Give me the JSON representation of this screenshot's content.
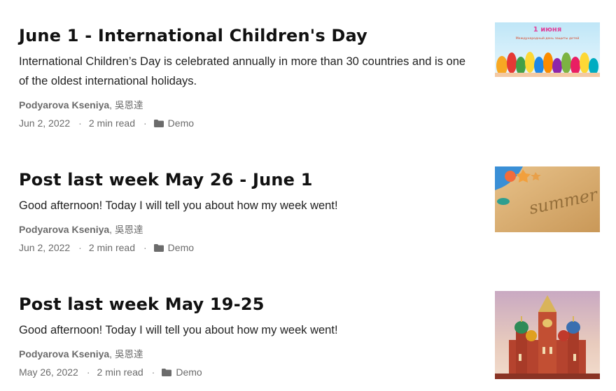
{
  "posts": [
    {
      "title": "June 1 - International Children's Day",
      "summary": "International Children’s Day is celebrated annually in more than 30 countries and is one of the oldest international holidays.",
      "author_primary": "Podyarova Kseniya",
      "author_separator": ",",
      "author_secondary": "吳恩達",
      "date": "Jun 2, 2022",
      "read_time": "2 min read",
      "category": "Demo",
      "meta_separator": "·",
      "image_icon": "childrens-day-thumbnail",
      "image_text_top": "1 июня",
      "image_text_sub": "Международный день защиты детей"
    },
    {
      "title": "Post last week May 26 - June 1",
      "summary": "Good afternoon! Today I will tell you about how my week went!",
      "author_primary": "Podyarova Kseniya",
      "author_separator": ",",
      "author_secondary": "吳恩達",
      "date": "Jun 2, 2022",
      "read_time": "2 min read",
      "category": "Demo",
      "meta_separator": "·",
      "image_icon": "summer-sand-thumbnail",
      "image_text_top": "summer"
    },
    {
      "title": "Post last week May 19-25",
      "summary": "Good afternoon! Today I will tell you about how my week went!",
      "author_primary": "Podyarova Kseniya",
      "author_separator": ",",
      "author_secondary": "吳恩達",
      "date": "May 26, 2022",
      "read_time": "2 min read",
      "category": "Demo",
      "meta_separator": "·",
      "image_icon": "moscow-cathedral-thumbnail"
    }
  ],
  "colors": {
    "title": "#111111",
    "text": "#222222",
    "meta": "#6b6b6b"
  }
}
